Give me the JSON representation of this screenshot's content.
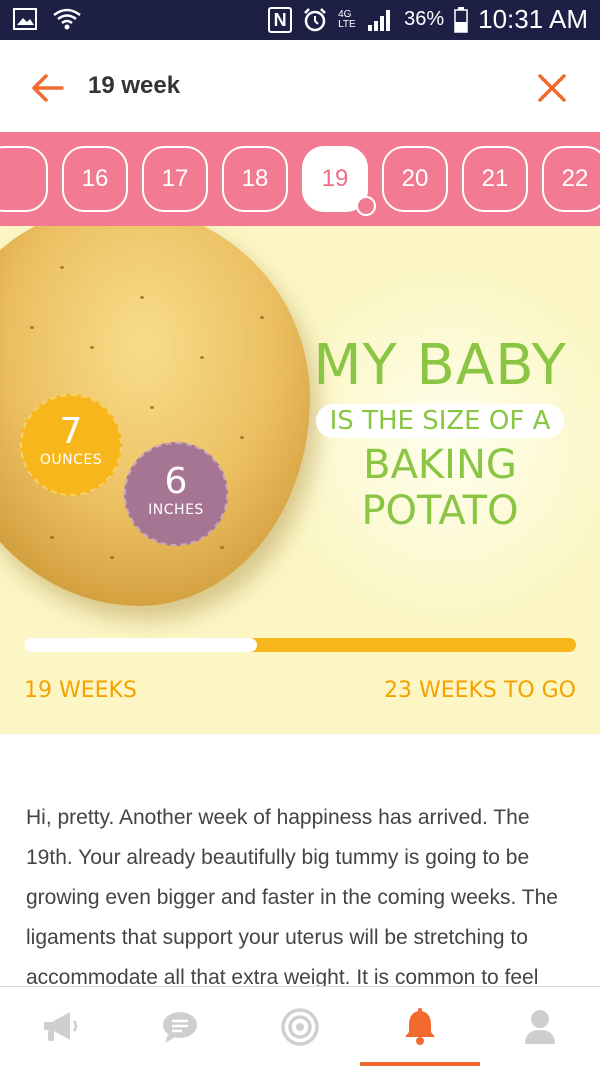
{
  "status_bar": {
    "battery_percent": "36%",
    "time": "10:31 AM",
    "network": "4G LTE",
    "icons": [
      "image-icon",
      "wifi-icon",
      "nfc-icon",
      "alarm-icon",
      "signal-icon",
      "battery-icon"
    ]
  },
  "header": {
    "title": "19 week",
    "back_icon": "arrow-left-icon",
    "close_icon": "close-icon",
    "accent_color": "#f26a2e"
  },
  "week_selector": {
    "weeks": [
      "16",
      "17",
      "18",
      "19",
      "20",
      "21",
      "22"
    ],
    "selected": "19",
    "background_color": "#f27b93"
  },
  "hero": {
    "weight_value": "7",
    "weight_unit": "OUNCES",
    "length_value": "6",
    "length_unit": "INCHES",
    "headline": "MY BABY",
    "subheadline": "IS THE SIZE OF A",
    "comparison": "BAKING POTATO",
    "progress_fraction": 0.4222,
    "weeks_done_label": "19 WEEKS",
    "weeks_left_label": "23 WEEKS TO GO"
  },
  "article": {
    "text": "Hi, pretty. Another week of happiness has arrived. The 19th. Your already beautifully big tummy is going to be growing even bigger and faster in the coming weeks. The ligaments that support your uterus will be stretching to accommodate all that extra weight. It is common to feel"
  },
  "bottom_nav": {
    "items": [
      {
        "icon": "megaphone-icon",
        "active": false
      },
      {
        "icon": "chat-icon",
        "active": false
      },
      {
        "icon": "target-icon",
        "active": false
      },
      {
        "icon": "bell-icon",
        "active": true
      },
      {
        "icon": "profile-icon",
        "active": false
      }
    ],
    "active_color": "#f26a2e"
  }
}
